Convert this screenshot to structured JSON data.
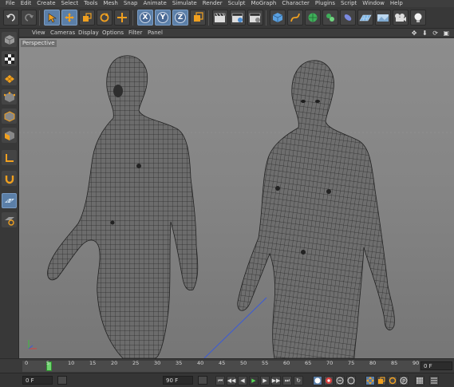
{
  "menu": [
    "File",
    "Edit",
    "Create",
    "Select",
    "Tools",
    "Mesh",
    "Snap",
    "Animate",
    "Simulate",
    "Render",
    "Sculpt",
    "MoGraph",
    "Character",
    "Plugins",
    "Script",
    "Window",
    "Help"
  ],
  "toolbar": {
    "axis_x": "X",
    "axis_y": "Y",
    "axis_z": "Z"
  },
  "viewport": {
    "menu": [
      "View",
      "Cameras",
      "Display",
      "Options",
      "Filter",
      "Panel"
    ],
    "title": "Perspective",
    "corner_icons": "✥ ⬇ ⟳ ▣"
  },
  "timeline": {
    "ticks": [
      "0",
      "5",
      "10",
      "15",
      "20",
      "25",
      "30",
      "35",
      "40",
      "45",
      "50",
      "55",
      "60",
      "65",
      "70",
      "75",
      "80",
      "85",
      "90"
    ],
    "end_frame": "0 F"
  },
  "transport": {
    "start_field": "0 F",
    "end_field": "90 F",
    "min_field": "0 F"
  },
  "colors": {
    "accent_blue": "#5b7fa8",
    "viewport_bg": "#858585",
    "timeline_green": "#6fd46f"
  }
}
